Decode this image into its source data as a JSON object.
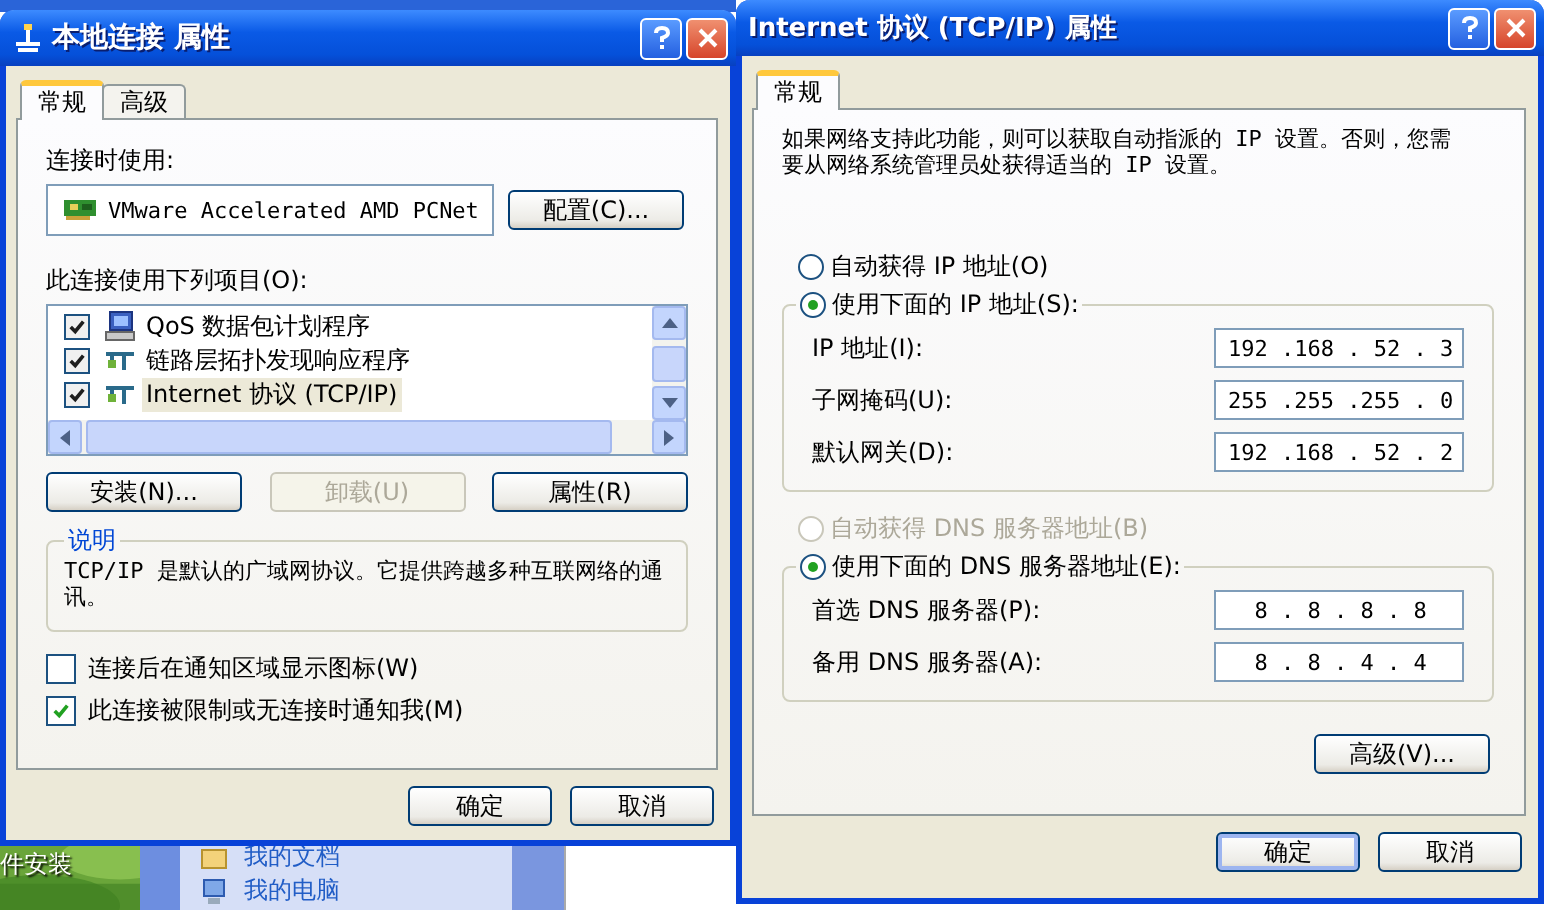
{
  "desktop": {
    "shortcut_label": "件安装",
    "task_links": [
      "我的文档",
      "我的电脑"
    ]
  },
  "connection_dialog": {
    "title": "本地连接 属性",
    "tabs": [
      {
        "label": "常规",
        "selected": true
      },
      {
        "label": "高级",
        "selected": false
      }
    ],
    "connect_using_label": "连接时使用:",
    "adapter": "VMware Accelerated AMD PCNet",
    "configure_button": "配置(C)...",
    "items_label": "此连接使用下列项目(O):",
    "components": [
      {
        "kind": "service",
        "label": "QoS 数据包计划程序",
        "checked": true,
        "selected": false
      },
      {
        "kind": "protocol",
        "label": "链路层拓扑发现响应程序",
        "checked": true,
        "selected": false
      },
      {
        "kind": "protocol",
        "label": "Internet 协议 (TCP/IP)",
        "checked": true,
        "selected": true
      }
    ],
    "actions": [
      {
        "label": "安装(N)...",
        "disabled": false
      },
      {
        "label": "卸载(U)",
        "disabled": true
      },
      {
        "label": "属性(R)",
        "disabled": false
      }
    ],
    "description": {
      "title": "说明",
      "text": "TCP/IP 是默认的广域网协议。它提供跨越多种互联网络的通讯。"
    },
    "options": [
      {
        "label": "连接后在通知区域显示图标(W)",
        "checked": false
      },
      {
        "label": "此连接被限制或无连接时通知我(M)",
        "checked": true
      }
    ],
    "buttons": [
      "确定",
      "取消"
    ]
  },
  "tcpip_dialog": {
    "title": "Internet 协议 (TCP/IP) 属性",
    "tabs": [
      {
        "label": "常规",
        "selected": true
      }
    ],
    "intro": "如果网络支持此功能，则可以获取自动指派的 IP 设置。否则，您需要从网络系统管理员处获得适当的 IP 设置。",
    "ip_modes": [
      {
        "label": "自动获得 IP 地址(O)",
        "selected": false,
        "disabled": false
      },
      {
        "label": "使用下面的 IP 地址(S):",
        "selected": true,
        "disabled": false
      }
    ],
    "ip_fields": [
      {
        "label": "IP 地址(I):",
        "value": "192 .168 . 52 . 3"
      },
      {
        "label": "子网掩码(U):",
        "value": "255 .255 .255 . 0"
      },
      {
        "label": "默认网关(D):",
        "value": "192 .168 . 52 . 2"
      }
    ],
    "dns_modes": [
      {
        "label": "自动获得 DNS 服务器地址(B)",
        "selected": false,
        "disabled": true
      },
      {
        "label": "使用下面的 DNS 服务器地址(E):",
        "selected": true,
        "disabled": false
      }
    ],
    "dns_fields": [
      {
        "label": "首选 DNS 服务器(P):",
        "value": "  8 . 8 . 8 . 8"
      },
      {
        "label": "备用 DNS 服务器(A):",
        "value": "  8 . 8 . 4 . 4"
      }
    ],
    "advanced_button": "高级(V)...",
    "buttons": [
      "确定",
      "取消"
    ]
  }
}
